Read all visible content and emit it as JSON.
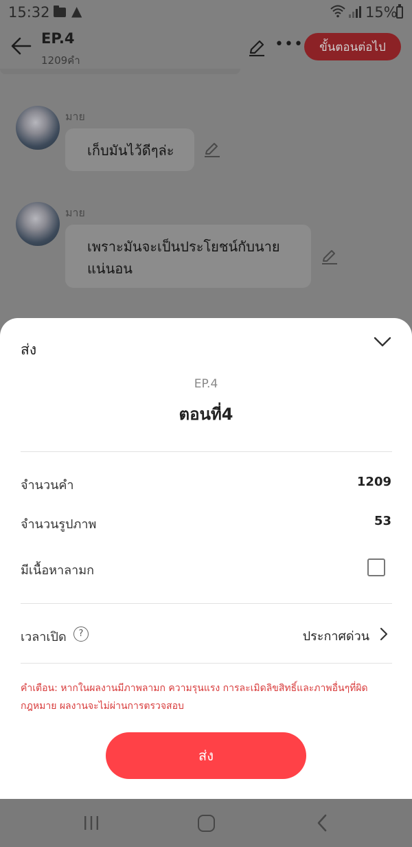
{
  "status_bar": {
    "time": "15:32",
    "battery": "15%"
  },
  "header": {
    "title": "EP.4",
    "subtitle": "1209คำ",
    "next_button": "ขั้นตอนต่อไป"
  },
  "chat": [
    {
      "name": "มาย",
      "message": "เก็บมันไว้ดีๆล่ะ"
    },
    {
      "name": "มาย",
      "message": "เพราะมันจะเป็นประโยชน์กับนายแน่นอน"
    }
  ],
  "sheet": {
    "title": "ส่ง",
    "episode_label": "EP.4",
    "episode_name": "ตอนที่4",
    "rows": {
      "word_count": {
        "label": "จำนวนคำ",
        "value": "1209"
      },
      "image_count": {
        "label": "จำนวนรูปภาพ",
        "value": "53"
      },
      "adult_content": {
        "label": "มีเนื้อหาลามก",
        "checked": false
      },
      "release_time": {
        "label": "เวลาเปิด",
        "help": "?",
        "value": "ประกาศด่วน"
      }
    },
    "warning": "คำเตือน: หากในผลงานมีภาพลามก ความรุนแรง การละเมิดลิขสิทธิ์และภาพอื่นๆที่ผิดกฎหมาย ผลงานจะไม่ผ่านการตรวจสอบ",
    "submit_button": "ส่ง"
  },
  "colors": {
    "accent": "#ff4147",
    "warning": "#d83b3b",
    "overlay": "#808080"
  },
  "icons": [
    "folder-icon",
    "warning-icon",
    "wifi-icon",
    "signal-icon",
    "battery-icon",
    "back-arrow-icon",
    "pencil-icon",
    "more-icon",
    "chevron-down-icon",
    "help-icon",
    "chevron-right-icon",
    "nav-recents-icon",
    "nav-home-icon",
    "nav-back-icon"
  ]
}
